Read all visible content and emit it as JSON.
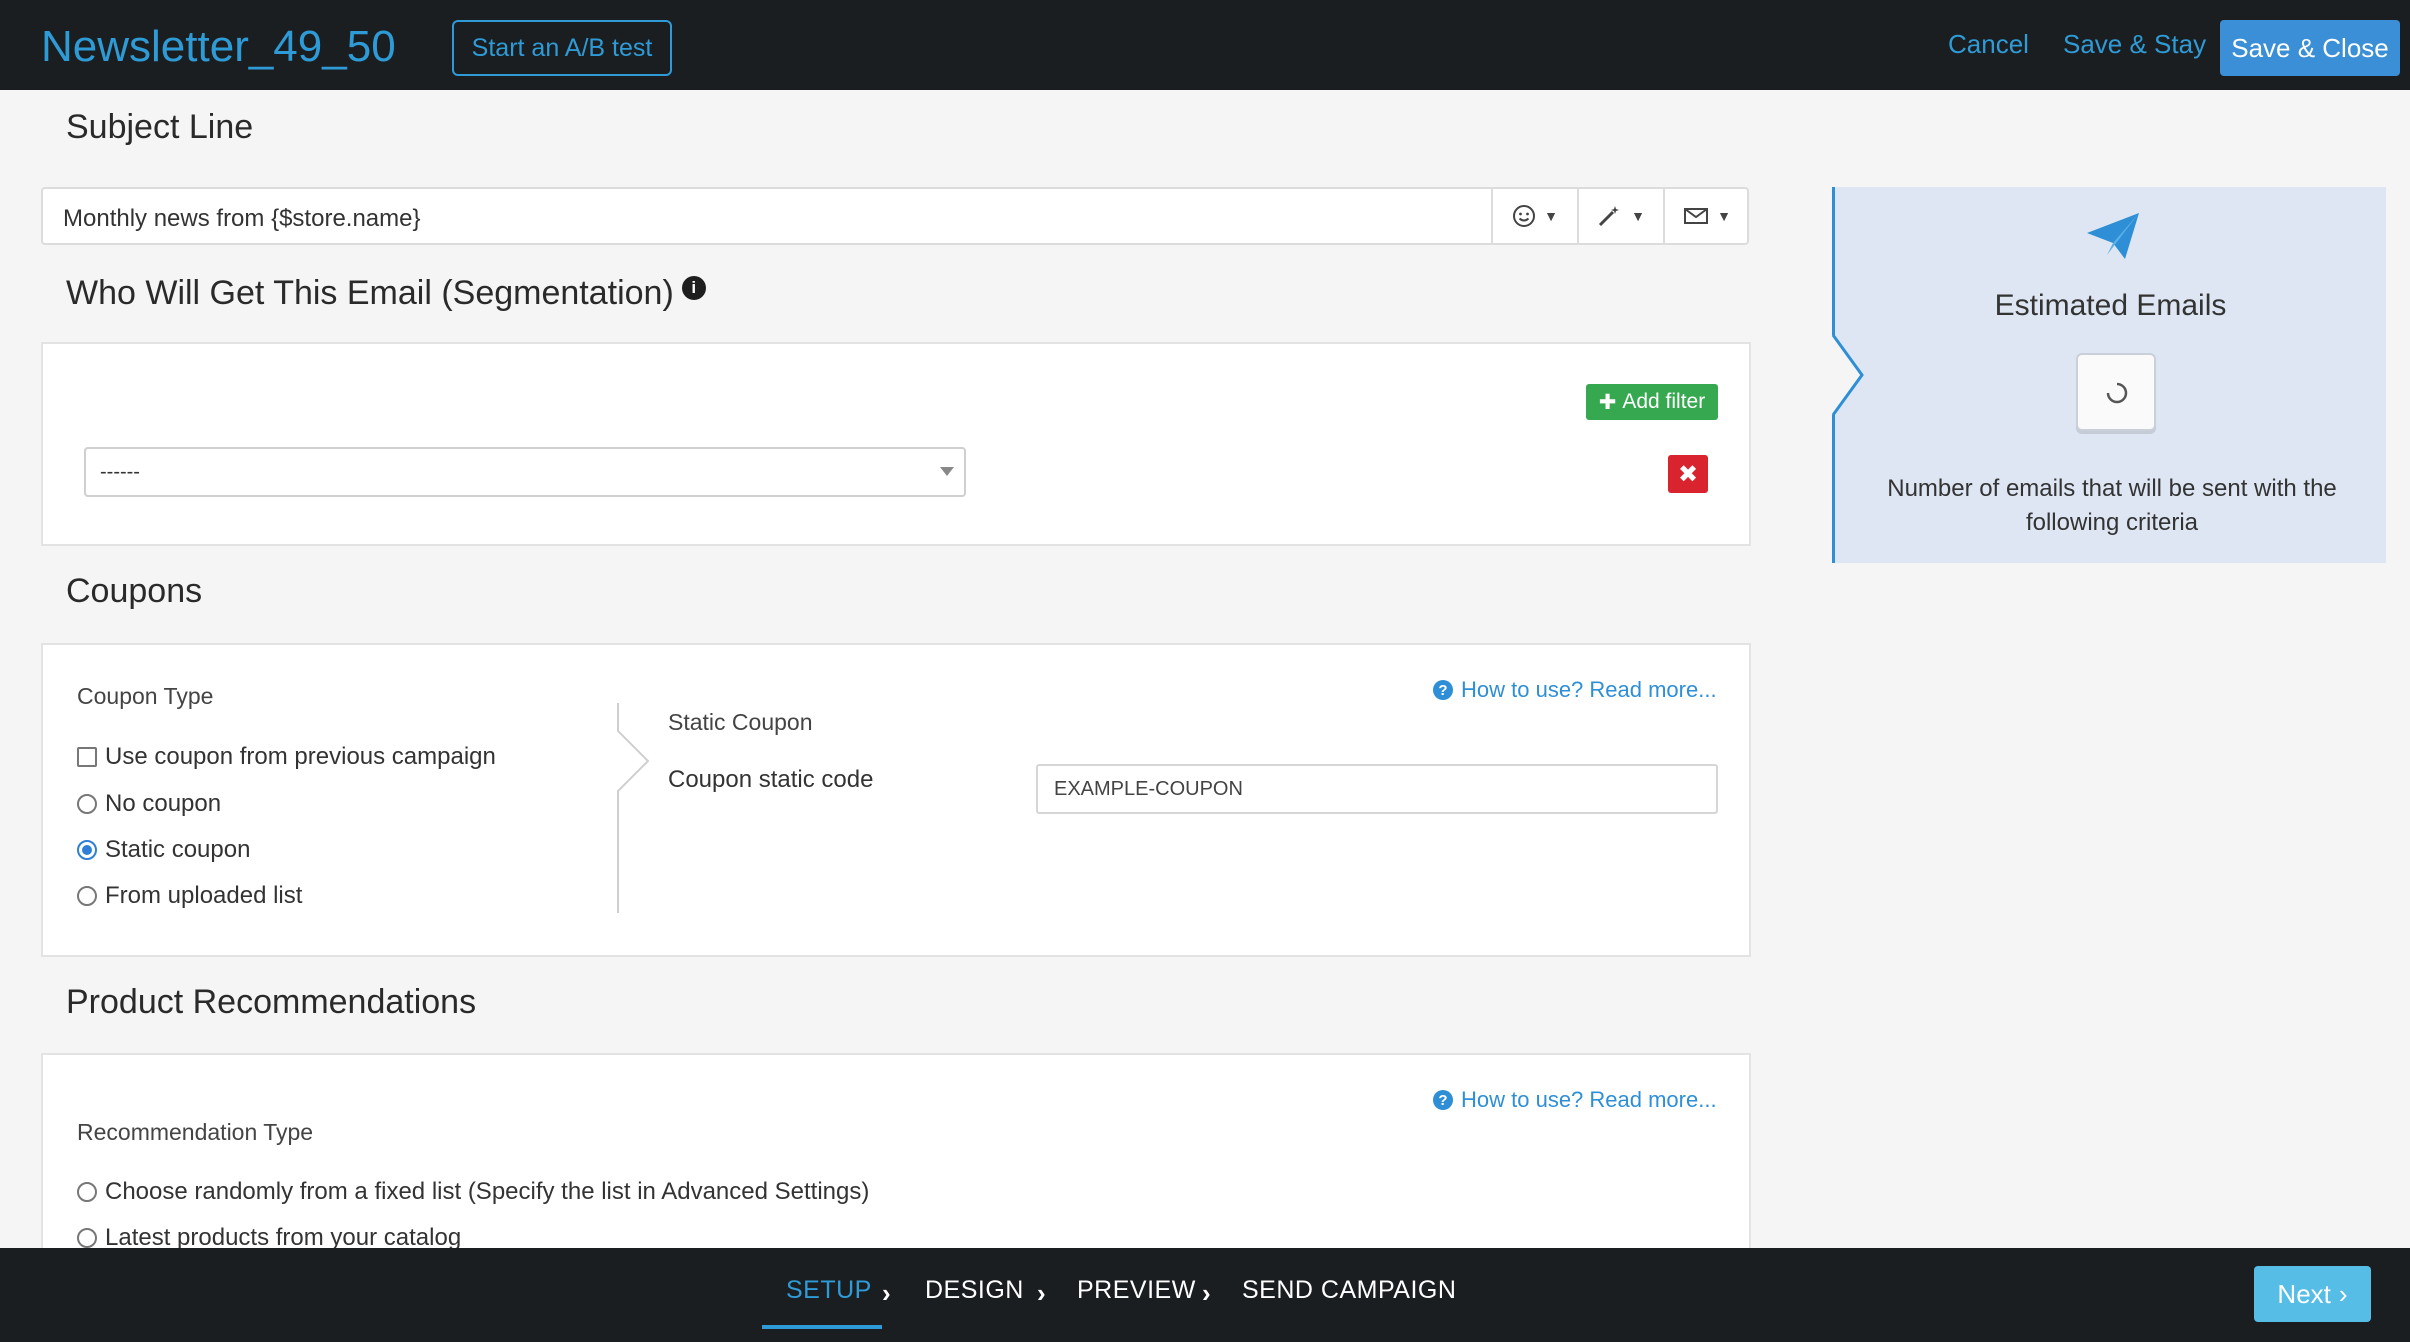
{
  "header": {
    "title": "Newsletter_49_50",
    "ab_test_label": "Start an A/B test",
    "cancel_label": "Cancel",
    "save_stay_label": "Save & Stay",
    "save_close_label": "Save & Close"
  },
  "subject": {
    "section_title": "Subject Line",
    "value": "Monthly news from {$store.name}",
    "tools": [
      "emoji-icon",
      "magic-wand-icon",
      "envelope-icon"
    ]
  },
  "segmentation": {
    "section_title": "Who Will Get This Email (Segmentation)",
    "info_icon_text": "i",
    "add_filter_label": "Add filter",
    "select_value": "------",
    "remove_icon_text": "✖"
  },
  "coupons": {
    "section_title": "Coupons",
    "type_label": "Coupon Type",
    "options": {
      "previous": "Use coupon from previous campaign",
      "none": "No coupon",
      "static": "Static coupon",
      "uploaded": "From uploaded list"
    },
    "selected": "static",
    "help_link": "How to use? Read more...",
    "static_title": "Static Coupon",
    "code_label": "Coupon static code",
    "code_value": "EXAMPLE-COUPON"
  },
  "recommendations": {
    "section_title": "Product Recommendations",
    "type_label": "Recommendation Type",
    "help_link": "How to use? Read more...",
    "options": {
      "random": "Choose randomly from a fixed list (Specify the list in Advanced Settings)",
      "latest": "Latest products from your catalog"
    }
  },
  "estimate": {
    "title": "Estimated Emails",
    "description": "Number of emails that will be sent with the following criteria",
    "accent": "#2e8fd6"
  },
  "footer": {
    "steps": [
      "SETUP",
      "DESIGN",
      "PREVIEW",
      "SEND CAMPAIGN"
    ],
    "active_step": "SETUP",
    "next_label": "Next"
  },
  "colors": {
    "brand_blue": "#2e9bd6",
    "dark_bar": "#1b1e21",
    "add_green": "#36a84f",
    "danger_red": "#d9232e"
  }
}
